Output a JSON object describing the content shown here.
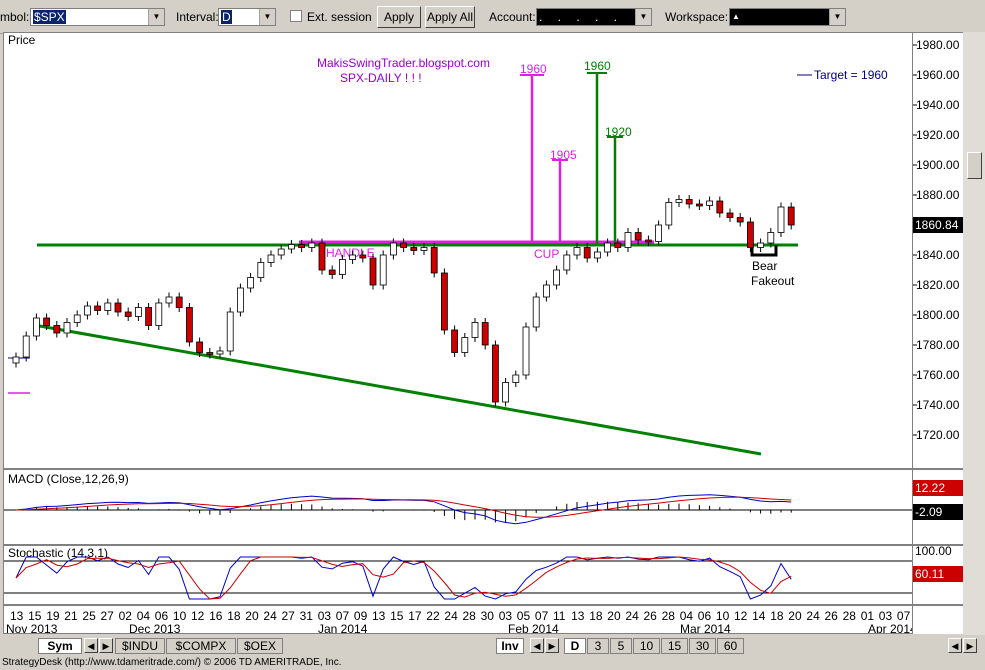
{
  "toolbar": {
    "symbol_label": "mbol:",
    "symbol_value": "$SPX",
    "interval_label": "Interval:",
    "interval_value": "D",
    "ext_session_label": "Ext. session",
    "apply_label": "Apply",
    "apply_all_label": "Apply All",
    "account_label": "Account:",
    "account_value": ". . . . .",
    "workspace_label": "Workspace:",
    "workspace_value": "▲"
  },
  "price_panel": {
    "title": "Price",
    "watermark_line1": "MakisSwingTrader.blogspot.com",
    "watermark_line2": "SPX-DAILY  ! ! !",
    "target_legend": "Target = 1960",
    "annotations": {
      "m1960": "1960",
      "m1905": "1905",
      "g1960": "1960",
      "g1920": "1920",
      "handle": "HANDLE",
      "cup": "CUP",
      "bear": "Bear",
      "fakeout": "Fakeout"
    },
    "price_axis": [
      "1980.00",
      "1960.00",
      "1940.00",
      "1920.00",
      "1900.00",
      "1880.00",
      "1840.00",
      "1820.00",
      "1800.00",
      "1780.00",
      "1760.00",
      "1740.00",
      "1720.00"
    ],
    "last_price": "1860.84"
  },
  "macd_panel": {
    "title": "MACD (Close,12,26,9)",
    "value1": "12.22",
    "value2": "-2.09"
  },
  "stoch_panel": {
    "title": "Stochastic (14,3,1)",
    "level_high": "100.00",
    "value": "60.11"
  },
  "date_axis": {
    "days": [
      "13",
      "15",
      "19",
      "21",
      "25",
      "27",
      "02",
      "04",
      "06",
      "10",
      "12",
      "16",
      "18",
      "20",
      "24",
      "27",
      "31",
      "03",
      "07",
      "09",
      "13",
      "15",
      "17",
      "22",
      "24",
      "28",
      "30",
      "03",
      "05",
      "07",
      "11",
      "13",
      "18",
      "20",
      "24",
      "26",
      "28",
      "04",
      "06",
      "10",
      "12",
      "14",
      "18",
      "20",
      "24",
      "26",
      "28",
      "01",
      "03",
      "07"
    ],
    "months": [
      "Nov 2013",
      "Dec 2013",
      "Jan 2014",
      "Feb 2014",
      "Mar 2014",
      "Apr 2014"
    ]
  },
  "tabs": {
    "sym": "Sym",
    "indu": "$INDU",
    "compx": "$COMPX",
    "oex": "$OEX",
    "inv": "Inv",
    "intervals": [
      "D",
      "3",
      "5",
      "10",
      "15",
      "30",
      "60"
    ]
  },
  "status": {
    "text": "StrategyDesk (http://www.tdameritrade.com/) © 2006 TD AMERITRADE, Inc."
  },
  "colors": {
    "green_line": "#008000",
    "magenta_line": "#e020e0",
    "up_candle": "#ffffff",
    "down_candle": "#cc0000",
    "target_blue": "#000080"
  },
  "chart_data": {
    "type": "candlestick",
    "closes": [
      1772,
      1786,
      1798,
      1793,
      1788,
      1795,
      1800,
      1806,
      1803,
      1808,
      1802,
      1799,
      1805,
      1793,
      1808,
      1812,
      1805,
      1782,
      1775,
      1774,
      1776,
      1802,
      1818,
      1825,
      1835,
      1840,
      1844,
      1847,
      1845,
      1848,
      1830,
      1827,
      1837,
      1840,
      1838,
      1820,
      1840,
      1848,
      1845,
      1843,
      1845,
      1828,
      1790,
      1775,
      1785,
      1795,
      1780,
      1742,
      1755,
      1760,
      1792,
      1812,
      1820,
      1830,
      1840,
      1845,
      1838,
      1842,
      1848,
      1845,
      1855,
      1850,
      1849,
      1860,
      1875,
      1877,
      1874,
      1873,
      1876,
      1868,
      1865,
      1862,
      1845,
      1848,
      1855,
      1872,
      1860
    ]
  }
}
